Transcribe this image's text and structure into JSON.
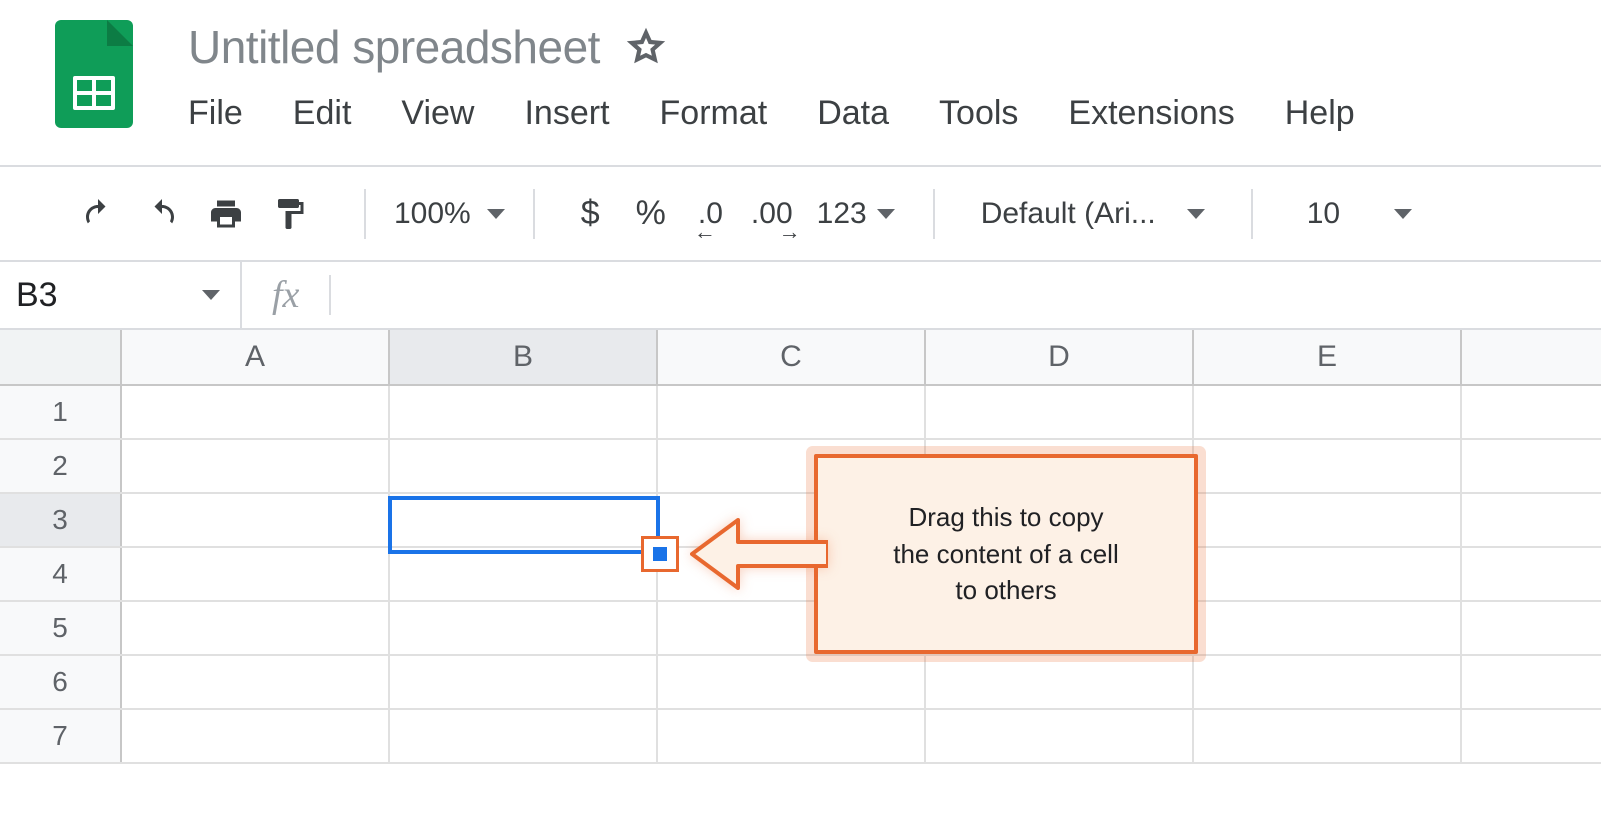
{
  "doc": {
    "title": "Untitled spreadsheet"
  },
  "menu": {
    "file": "File",
    "edit": "Edit",
    "view": "View",
    "insert": "Insert",
    "format": "Format",
    "data": "Data",
    "tools": "Tools",
    "extensions": "Extensions",
    "help": "Help"
  },
  "toolbar": {
    "zoom": "100%",
    "currency": "$",
    "percent": "%",
    "dec_decrease": ".0",
    "dec_increase": ".00",
    "format_more": "123",
    "font": "Default (Ari...",
    "font_size": "10"
  },
  "formula_bar": {
    "name_box": "B3",
    "fx_label": "fx",
    "formula": ""
  },
  "grid": {
    "columns": [
      "A",
      "B",
      "C",
      "D",
      "E"
    ],
    "rows": [
      "1",
      "2",
      "3",
      "4",
      "5",
      "6",
      "7"
    ],
    "active_column": "B",
    "active_row": "3",
    "selected_cell": "B3"
  },
  "callout": {
    "line1": "Drag this to copy",
    "line2": "the content of a cell",
    "line3": "to others"
  }
}
